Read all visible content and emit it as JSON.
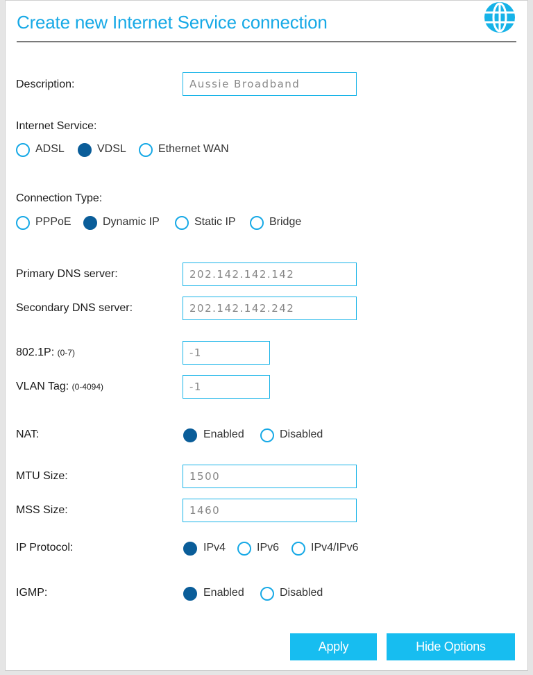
{
  "header": {
    "title": "Create new Internet Service connection"
  },
  "description": {
    "label": "Description:",
    "value": "Aussie Broadband"
  },
  "internet_service": {
    "label": "Internet Service:",
    "options": [
      "ADSL",
      "VDSL",
      "Ethernet WAN"
    ],
    "selected": "VDSL"
  },
  "connection_type": {
    "label": "Connection Type:",
    "options": [
      "PPPoE",
      "Dynamic IP",
      "Static IP",
      "Bridge"
    ],
    "selected": "Dynamic IP"
  },
  "dns": {
    "primary_label": "Primary DNS server:",
    "primary_value": "202.142.142.142",
    "secondary_label": "Secondary DNS server:",
    "secondary_value": "202.142.142.242"
  },
  "p8021": {
    "label": "802.1P:",
    "hint": "(0-7)",
    "value": "-1"
  },
  "vlan": {
    "label": "VLAN Tag:",
    "hint": "(0-4094)",
    "value": "-1"
  },
  "nat": {
    "label": "NAT:",
    "options": [
      "Enabled",
      "Disabled"
    ],
    "selected": "Enabled"
  },
  "mtu": {
    "label": "MTU Size:",
    "value": "1500"
  },
  "mss": {
    "label": "MSS Size:",
    "value": "1460"
  },
  "ip_protocol": {
    "label": "IP Protocol:",
    "options": [
      "IPv4",
      "IPv6",
      "IPv4/IPv6"
    ],
    "selected": "IPv4"
  },
  "igmp": {
    "label": "IGMP:",
    "options": [
      "Enabled",
      "Disabled"
    ],
    "selected": "Enabled"
  },
  "buttons": {
    "apply": "Apply",
    "hide_options": "Hide Options"
  },
  "colors": {
    "accent": "#17a9e6",
    "radio_selected": "#0a5d99",
    "button": "#17bdf0"
  },
  "icons": {
    "header": "globe-icon"
  }
}
